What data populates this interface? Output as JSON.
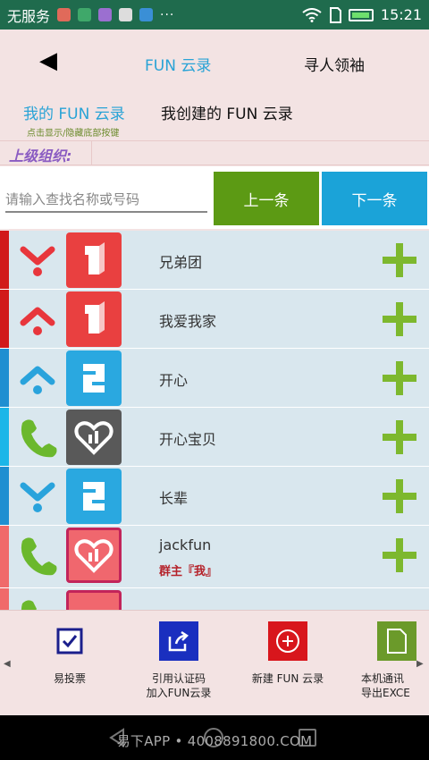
{
  "status_bar": {
    "carrier": "无服务",
    "dots": "···",
    "time": "15:21",
    "app_icon_colors": [
      "#e06a5a",
      "#3fa86a",
      "#9b6fd0",
      "#dddddd",
      "#3a8fd6"
    ]
  },
  "header": {
    "back_symbol": "◀",
    "title": "FUN 云录",
    "find_leader": "寻人领袖"
  },
  "tabs": {
    "mine_label": "我的 FUN 云录",
    "mine_hint": "点击显示/隐藏底部按键",
    "created_label": "我创建的 FUN 云录"
  },
  "parent_org": {
    "label": "上级组织:"
  },
  "search": {
    "placeholder": "请输入查找名称或号码",
    "prev_label": "上一条",
    "next_label": "下一条"
  },
  "list": [
    {
      "name": "兄弟团",
      "sub": "",
      "lead_icon": "chevron-down-icon",
      "badge_icon": "level-1-icon",
      "badge_number": "1",
      "stripe": "#d11a1a",
      "badge_bg": "#e94040",
      "lead_color": "#e8363c"
    },
    {
      "name": "我爱我家",
      "sub": "",
      "lead_icon": "chevron-up-icon",
      "badge_icon": "level-1-icon",
      "badge_number": "1",
      "stripe": "#d11a1a",
      "badge_bg": "#e94040",
      "lead_color": "#e8363c"
    },
    {
      "name": "开心",
      "sub": "",
      "lead_icon": "chevron-up-icon",
      "badge_icon": "level-2-icon",
      "badge_number": "2",
      "stripe": "#1f8fd1",
      "badge_bg": "#2aa8e0",
      "lead_color": "#29a3dc"
    },
    {
      "name": "开心宝贝",
      "sub": "",
      "lead_icon": "phone-icon",
      "badge_icon": "heart-icon",
      "badge_number": "",
      "stripe": "#1bb6e8",
      "badge_bg": "#595959",
      "lead_color": "#6bb82d"
    },
    {
      "name": "长辈",
      "sub": "",
      "lead_icon": "chevron-down-icon",
      "badge_icon": "level-2-icon",
      "badge_number": "2",
      "stripe": "#1f8fd1",
      "badge_bg": "#2aa8e0",
      "lead_color": "#29a3dc"
    },
    {
      "name": "jackfun",
      "sub": "群主『我』",
      "lead_icon": "phone-icon",
      "badge_icon": "heart-icon",
      "badge_number": "",
      "stripe": "#f06a6a",
      "badge_bg": "#f0676e",
      "lead_color": "#6bb82d"
    }
  ],
  "toolbar": {
    "vote_label": "易投票",
    "cite_line1": "引用认证码",
    "cite_line2": "加入FUN云录",
    "new_label": "新建 FUN 云录",
    "export_line1": "本机通讯",
    "export_line2": "导出EXCE",
    "left_arrow": "◀",
    "right_arrow": "▶"
  },
  "watermark": "易下APP • 4008891800.COM",
  "colors": {
    "accent_blue": "#29a3d6",
    "prev_green": "#5c9a14",
    "next_blue": "#1ba3d8",
    "plus_green": "#7db82e"
  }
}
